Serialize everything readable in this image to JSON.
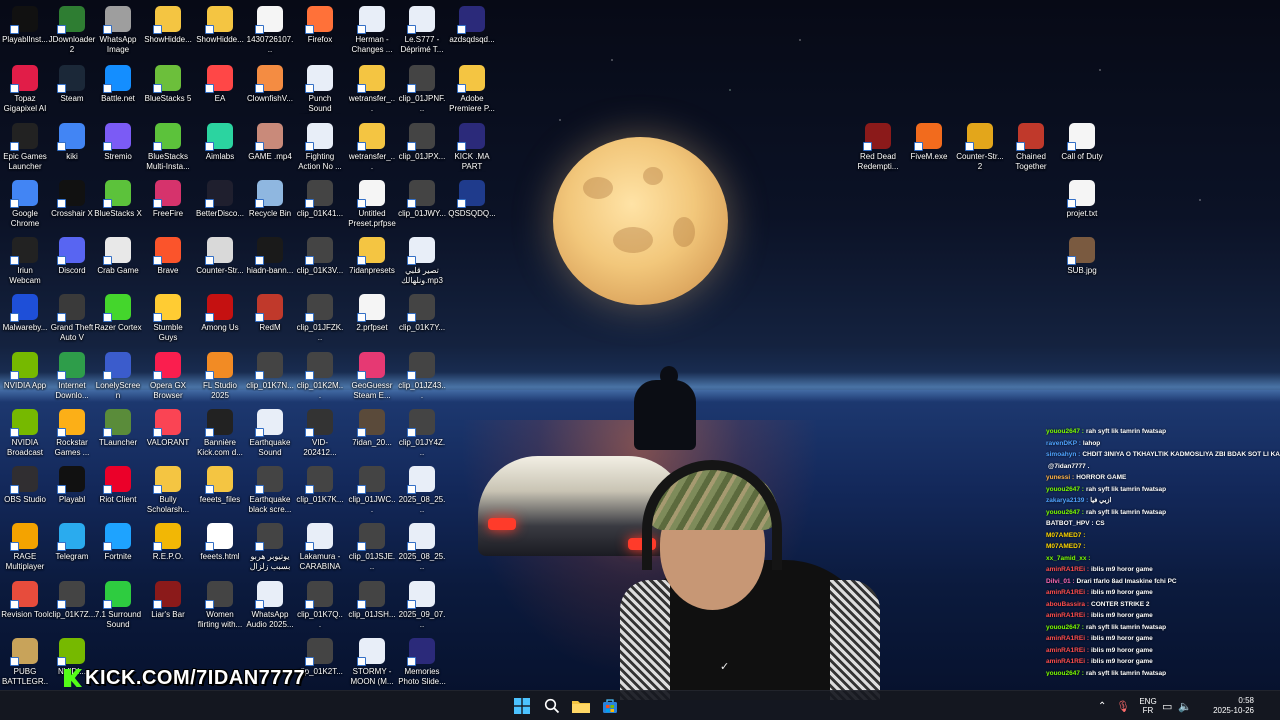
{
  "desktop": {
    "icons": [
      {
        "label": "PlayablInst...",
        "color": "#111111"
      },
      {
        "label": "JDownloader 2",
        "color": "#2e7d32"
      },
      {
        "label": "WhatsApp Image 2025...",
        "color": "#9e9e9e"
      },
      {
        "label": "ShowHidde...",
        "color": "#f4c542"
      },
      {
        "label": "ShowHidde...",
        "color": "#f4c542"
      },
      {
        "label": "1430726107...",
        "color": "#f5f5f5"
      },
      {
        "label": "Firefox",
        "color": "#ff7139"
      },
      {
        "label": "Herman - Changes ...",
        "color": "#e8eef8"
      },
      {
        "label": "Le.S777 - Déprimé T...",
        "color": "#e8eef8"
      },
      {
        "label": "azdsqdsqd...",
        "color": "#2b2a7a"
      },
      {
        "label": "Topaz Gigapixel AI",
        "color": "#e11d48"
      },
      {
        "label": "Steam",
        "color": "#1b2838"
      },
      {
        "label": "Battle.net",
        "color": "#148eff"
      },
      {
        "label": "BlueStacks 5",
        "color": "#6cbf3b"
      },
      {
        "label": "EA",
        "color": "#ff4747"
      },
      {
        "label": "ClownfishV...",
        "color": "#f48c42"
      },
      {
        "label": "Punch Sound Effect..mp3",
        "color": "#e8eef8"
      },
      {
        "label": "wetransfer_...",
        "color": "#f4c542"
      },
      {
        "label": "clip_01JPNF...",
        "color": "#444444"
      },
      {
        "label": "Adobe Premiere P...",
        "color": "#f4c542"
      },
      {
        "label": "Epic Games Launcher",
        "color": "#222222"
      },
      {
        "label": "kiki",
        "color": "#4285f4"
      },
      {
        "label": "Stremio",
        "color": "#7b5bf5"
      },
      {
        "label": "BlueStacks Multi-Insta...",
        "color": "#5cc23b"
      },
      {
        "label": "Aimlabs",
        "color": "#2bd4a0"
      },
      {
        "label": "GAME .mp4",
        "color": "#c98a7a"
      },
      {
        "label": "Fighting Action No ...",
        "color": "#e8eef8"
      },
      {
        "label": "wetransfer_...",
        "color": "#f4c542"
      },
      {
        "label": "clip_01JPX...",
        "color": "#444444"
      },
      {
        "label": "KICK .MA PART 2.prproj",
        "color": "#2b2a7a"
      },
      {
        "label": "Google Chrome",
        "color": "#4285f4"
      },
      {
        "label": "Crosshair X",
        "color": "#111111"
      },
      {
        "label": "BlueStacks X",
        "color": "#5cc23b"
      },
      {
        "label": "FreeFire",
        "color": "#d6336c"
      },
      {
        "label": "BetterDisco...",
        "color": "#1f1f2e"
      },
      {
        "label": "Recycle Bin",
        "color": "#8fb7e0"
      },
      {
        "label": "clip_01K41...",
        "color": "#444444"
      },
      {
        "label": "Untitled Preset.prfpset",
        "color": "#f5f5f5"
      },
      {
        "label": "clip_01JWY...",
        "color": "#444444"
      },
      {
        "label": "QSDSQDQ...",
        "color": "#1f3b8c"
      },
      {
        "label": "Iriun Webcam",
        "color": "#222222"
      },
      {
        "label": "Discord",
        "color": "#5865f2"
      },
      {
        "label": "Crab Game",
        "color": "#e8e8e8"
      },
      {
        "label": "Brave",
        "color": "#fb542b"
      },
      {
        "label": "Counter-Str...",
        "color": "#d9d9d9"
      },
      {
        "label": "hiadn-bann...",
        "color": "#1a1a1a"
      },
      {
        "label": "clip_01K3V...",
        "color": "#444444"
      },
      {
        "label": "7idanpresets",
        "color": "#f4c542"
      },
      {
        "label": "تصير قلبي ونلهالك.mp3",
        "color": "#e8eef8"
      },
      {
        "label": "Malwareby...",
        "color": "#1e4fd8"
      },
      {
        "label": "Grand Theft Auto V",
        "color": "#3a3a3a"
      },
      {
        "label": "Razer Cortex",
        "color": "#44d62c"
      },
      {
        "label": "Stumble Guys",
        "color": "#ffcc33"
      },
      {
        "label": "Among Us",
        "color": "#c51111"
      },
      {
        "label": "RedM",
        "color": "#c0392b"
      },
      {
        "label": "clip_01JFZK...",
        "color": "#444444"
      },
      {
        "label": "2.prfpset",
        "color": "#f5f5f5"
      },
      {
        "label": "clip_01K7Y...",
        "color": "#444444"
      },
      {
        "label": "NVIDIA App",
        "color": "#76b900"
      },
      {
        "label": "Internet Downlo...",
        "color": "#2e9d4a"
      },
      {
        "label": "LonelyScreen",
        "color": "#3b5ccc"
      },
      {
        "label": "Opera GX Browser",
        "color": "#fa1e4e"
      },
      {
        "label": "FL Studio 2025",
        "color": "#f28b24"
      },
      {
        "label": "clip_01K7N...",
        "color": "#444444"
      },
      {
        "label": "clip_01K2M...",
        "color": "#444444"
      },
      {
        "label": "GeoGuessr Steam E...",
        "color": "#e63973"
      },
      {
        "label": "clip_01JZ43...",
        "color": "#444444"
      },
      {
        "label": "NVIDIA Broadcast",
        "color": "#76b900"
      },
      {
        "label": "Rockstar Games ...",
        "color": "#fcaf17"
      },
      {
        "label": "TLauncher",
        "color": "#5a8c3a"
      },
      {
        "label": "VALORANT",
        "color": "#fa4454"
      },
      {
        "label": "Bannière Kick.com d...",
        "color": "#222222"
      },
      {
        "label": "Earthquake Sound Effec...",
        "color": "#e8eef8"
      },
      {
        "label": "VID-202412... (1).mp4",
        "color": "#333333"
      },
      {
        "label": "7idan_20...",
        "color": "#5a4a3a"
      },
      {
        "label": "clip_01JY4Z...",
        "color": "#444444"
      },
      {
        "label": "OBS Studio",
        "color": "#302e31"
      },
      {
        "label": "Playabl",
        "color": "#111111"
      },
      {
        "label": "Riot Client",
        "color": "#eb0029"
      },
      {
        "label": "Bully Scholarsh...",
        "color": "#f4c542"
      },
      {
        "label": "feeets_files",
        "color": "#f4c542"
      },
      {
        "label": "Earthquake black scre...",
        "color": "#444444"
      },
      {
        "label": "clip_01K7K...",
        "color": "#444444"
      },
      {
        "label": "clip_01JWC...",
        "color": "#444444"
      },
      {
        "label": "2025_08_25...",
        "color": "#e8eef8"
      },
      {
        "label": "RAGE Multiplayer",
        "color": "#f4a300"
      },
      {
        "label": "Telegram",
        "color": "#2aabee"
      },
      {
        "label": "Fortnite",
        "color": "#1ea3ff"
      },
      {
        "label": "R.E.P.O.",
        "color": "#f2b705"
      },
      {
        "label": "feeets.html",
        "color": "#ffffff"
      },
      {
        "label": "يوتيوبر هربو بسبب زلزال",
        "color": "#444444"
      },
      {
        "label": "Lakamura - CARABINA ...",
        "color": "#e8eef8"
      },
      {
        "label": "clip_01JSJE...",
        "color": "#444444"
      },
      {
        "label": "2025_08_25...",
        "color": "#e8eef8"
      },
      {
        "label": "Revision Tool",
        "color": "#e74c3c"
      },
      {
        "label": "clip_01K7Z...",
        "color": "#444444"
      },
      {
        "label": "7.1 Surround Sound",
        "color": "#2ecc40"
      },
      {
        "label": "Liar's Bar",
        "color": "#8b1a1a"
      },
      {
        "label": "Women flirting with...",
        "color": "#444444"
      },
      {
        "label": "WhatsApp Audio 2025...",
        "color": "#e8eef8"
      },
      {
        "label": "clip_01K7Q...",
        "color": "#444444"
      },
      {
        "label": "clip_01JSH...",
        "color": "#444444"
      },
      {
        "label": "2025_09_07...",
        "color": "#e8eef8"
      },
      {
        "label": "PUBG BATTLEGR...",
        "color": "#c8a35a"
      },
      {
        "label": "NVIDI...",
        "color": "#76b900"
      },
      {
        "label": "clip_01K2T...",
        "color": "#444444"
      },
      {
        "label": "STORMY - MOON (M...",
        "color": "#e8eef8"
      },
      {
        "label": "Memories Photo Slide...",
        "color": "#2b2a7a"
      },
      {
        "label": "Red Dead Redempti...",
        "color": "#8b1a1a"
      },
      {
        "label": "FiveM.exe",
        "color": "#f26b1d"
      },
      {
        "label": "Counter-Str... 2",
        "color": "#e3a61b"
      },
      {
        "label": "Chained Together",
        "color": "#c0392b"
      },
      {
        "label": "Call of Duty",
        "color": "#f5f5f5"
      },
      {
        "label": "projet.txt",
        "color": "#f5f5f5"
      },
      {
        "label": "SUB.jpg",
        "color": "#7a5a40"
      }
    ]
  },
  "overlay": {
    "kick_url": "KICK.COM/7IDAN7777"
  },
  "chat": {
    "messages": [
      {
        "user": "youou2647 :",
        "text": "rah syft lik tamrin fwatsap",
        "color": "#7cfc00"
      },
      {
        "user": "ravenDKP :",
        "text": "lahop",
        "color": "#4fa3ff"
      },
      {
        "user": "simoahyn :",
        "text": "CHDIT 3INIYA O TKHAYLTIK KADMOSLIYA ZBI BDAK SOT LI KADIR FLMA",
        "color": "#4fa3ff"
      },
      {
        "user": "",
        "text": "@7idan7777 .",
        "color": "#ffffff"
      },
      {
        "user": "yunessi :",
        "text": "HORROR GAME",
        "color": "#ffb347"
      },
      {
        "user": "youou2647 :",
        "text": "rah syft lik tamrin fwatsap",
        "color": "#7cfc00"
      },
      {
        "user": "zakarya2139 :",
        "text": "ازبي فيا",
        "color": "#4fa3ff"
      },
      {
        "user": "youou2647 :",
        "text": "rah syft lik tamrin fwatsap",
        "color": "#7cfc00"
      },
      {
        "user": "BATBOT_HPV :",
        "text": "CS",
        "color": "#ffffff"
      },
      {
        "user": "M07AMED7 :",
        "text": "",
        "color": "#ffd700"
      },
      {
        "user": "M07AMED7 :",
        "text": "",
        "color": "#ffd700"
      },
      {
        "user": "xx_7amid_xx :",
        "text": "",
        "color": "#7cfc00"
      },
      {
        "user": "aminRA1REi :",
        "text": "iblis m9 horor game",
        "color": "#ff4d4d"
      },
      {
        "user": "Dilvi_01 :",
        "text": "Drari tfarlo 8ad lmaskine fchi PC",
        "color": "#ff69b4"
      },
      {
        "user": "aminRA1REi :",
        "text": "iblis m9 horor game",
        "color": "#ff4d4d"
      },
      {
        "user": "abouBassira :",
        "text": "CONTER STRIKE 2",
        "color": "#ff4d4d"
      },
      {
        "user": "aminRA1REi :",
        "text": "iblis m9 horor game",
        "color": "#ff4d4d"
      },
      {
        "user": "youou2647 :",
        "text": "rah syft lik tamrin fwatsap",
        "color": "#7cfc00"
      },
      {
        "user": "aminRA1REi :",
        "text": "iblis m9 horor game",
        "color": "#ff4d4d"
      },
      {
        "user": "aminRA1REi :",
        "text": "iblis m9 horor game",
        "color": "#ff4d4d"
      },
      {
        "user": "aminRA1REi :",
        "text": "iblis m9 horor game",
        "color": "#ff4d4d"
      },
      {
        "user": "youou2647 :",
        "text": "rah syft lik tamrin fwatsap",
        "color": "#7cfc00"
      }
    ]
  },
  "taskbar": {
    "apps": [
      {
        "name": "start-button",
        "glyph": "⊞",
        "color": "#4cc2ff"
      },
      {
        "name": "search-button",
        "glyph": "⌕",
        "color": "#ffffff"
      },
      {
        "name": "file-explorer-button",
        "glyph": "▬",
        "color": "#f4c542"
      },
      {
        "name": "store-button",
        "glyph": "◼",
        "color": "#4cc2ff"
      }
    ],
    "language_line1": "ENG",
    "language_line2": "FR",
    "time": "0:58",
    "date": "2025-10-26"
  }
}
